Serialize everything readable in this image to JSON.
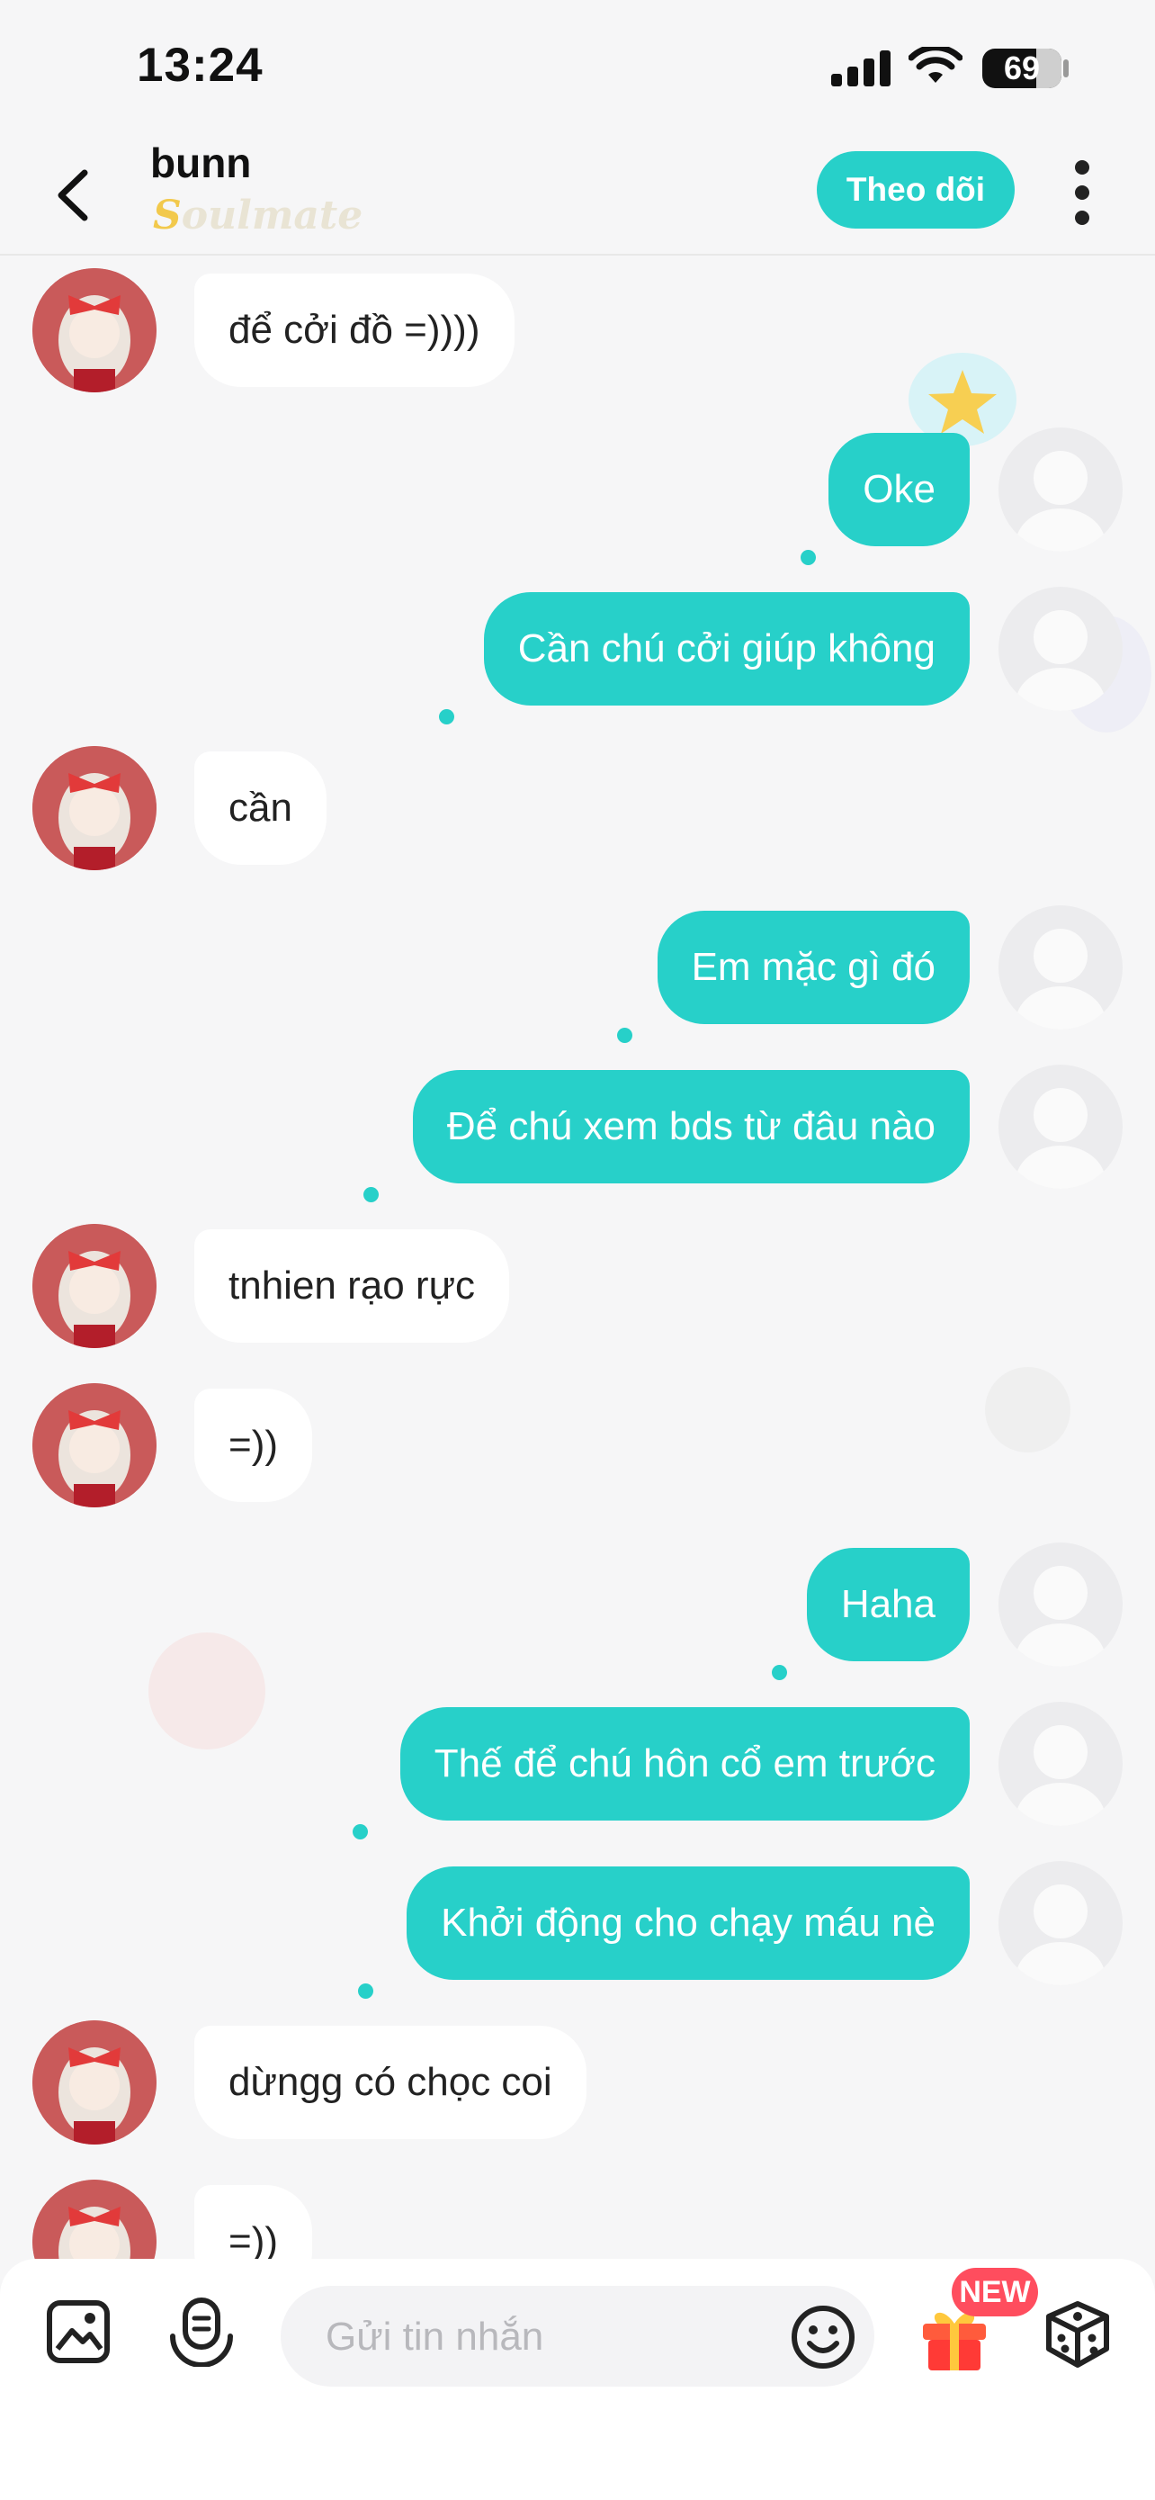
{
  "status_bar": {
    "time": "13:24",
    "battery": "69"
  },
  "header": {
    "title": "bunn",
    "subtitle_first": "S",
    "subtitle_rest": "oulmate",
    "follow_label": "Theo dõi"
  },
  "messages": [
    {
      "side": "left",
      "text": "để cởi đồ =))))"
    },
    {
      "side": "right",
      "text": "Oke"
    },
    {
      "side": "right",
      "text": "Cần chú cởi giúp không"
    },
    {
      "side": "left",
      "text": "cần"
    },
    {
      "side": "right",
      "text": "Em mặc gì đó"
    },
    {
      "side": "right",
      "text": "Để chú xem bds từ đâu nào"
    },
    {
      "side": "left",
      "text": "tnhien rạo rực"
    },
    {
      "side": "left",
      "text": "=))"
    },
    {
      "side": "right",
      "text": "Haha"
    },
    {
      "side": "right",
      "text": "Thế để chú hôn cổ em trước"
    },
    {
      "side": "right",
      "text": "Khởi động cho chạy máu nè"
    },
    {
      "side": "left",
      "text": "dừngg có chọc coi"
    },
    {
      "side": "left",
      "text": "=))"
    }
  ],
  "composer": {
    "placeholder": "Gửi tin nhắn",
    "gift_badge": "NEW"
  },
  "colors": {
    "accent": "#27d0c9",
    "badge": "#ff4d5e",
    "background": "#f6f6f7"
  },
  "icons": [
    "back-arrow-icon",
    "more-vertical-icon",
    "image-icon",
    "voice-icon",
    "emoji-icon",
    "gift-icon",
    "dice-icon"
  ]
}
